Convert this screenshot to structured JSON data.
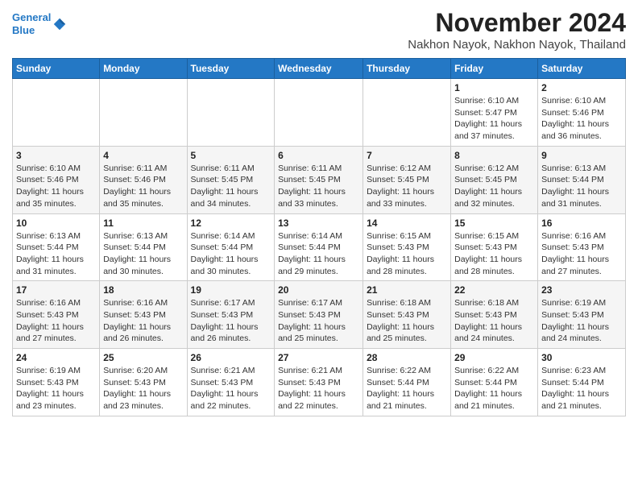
{
  "header": {
    "logo_line1": "General",
    "logo_line2": "Blue",
    "title": "November 2024",
    "subtitle": "Nakhon Nayok, Nakhon Nayok, Thailand"
  },
  "days_of_week": [
    "Sunday",
    "Monday",
    "Tuesday",
    "Wednesday",
    "Thursday",
    "Friday",
    "Saturday"
  ],
  "weeks": [
    [
      {
        "day": "",
        "info": ""
      },
      {
        "day": "",
        "info": ""
      },
      {
        "day": "",
        "info": ""
      },
      {
        "day": "",
        "info": ""
      },
      {
        "day": "",
        "info": ""
      },
      {
        "day": "1",
        "info": "Sunrise: 6:10 AM\nSunset: 5:47 PM\nDaylight: 11 hours\nand 37 minutes."
      },
      {
        "day": "2",
        "info": "Sunrise: 6:10 AM\nSunset: 5:46 PM\nDaylight: 11 hours\nand 36 minutes."
      }
    ],
    [
      {
        "day": "3",
        "info": "Sunrise: 6:10 AM\nSunset: 5:46 PM\nDaylight: 11 hours\nand 35 minutes."
      },
      {
        "day": "4",
        "info": "Sunrise: 6:11 AM\nSunset: 5:46 PM\nDaylight: 11 hours\nand 35 minutes."
      },
      {
        "day": "5",
        "info": "Sunrise: 6:11 AM\nSunset: 5:45 PM\nDaylight: 11 hours\nand 34 minutes."
      },
      {
        "day": "6",
        "info": "Sunrise: 6:11 AM\nSunset: 5:45 PM\nDaylight: 11 hours\nand 33 minutes."
      },
      {
        "day": "7",
        "info": "Sunrise: 6:12 AM\nSunset: 5:45 PM\nDaylight: 11 hours\nand 33 minutes."
      },
      {
        "day": "8",
        "info": "Sunrise: 6:12 AM\nSunset: 5:45 PM\nDaylight: 11 hours\nand 32 minutes."
      },
      {
        "day": "9",
        "info": "Sunrise: 6:13 AM\nSunset: 5:44 PM\nDaylight: 11 hours\nand 31 minutes."
      }
    ],
    [
      {
        "day": "10",
        "info": "Sunrise: 6:13 AM\nSunset: 5:44 PM\nDaylight: 11 hours\nand 31 minutes."
      },
      {
        "day": "11",
        "info": "Sunrise: 6:13 AM\nSunset: 5:44 PM\nDaylight: 11 hours\nand 30 minutes."
      },
      {
        "day": "12",
        "info": "Sunrise: 6:14 AM\nSunset: 5:44 PM\nDaylight: 11 hours\nand 30 minutes."
      },
      {
        "day": "13",
        "info": "Sunrise: 6:14 AM\nSunset: 5:44 PM\nDaylight: 11 hours\nand 29 minutes."
      },
      {
        "day": "14",
        "info": "Sunrise: 6:15 AM\nSunset: 5:43 PM\nDaylight: 11 hours\nand 28 minutes."
      },
      {
        "day": "15",
        "info": "Sunrise: 6:15 AM\nSunset: 5:43 PM\nDaylight: 11 hours\nand 28 minutes."
      },
      {
        "day": "16",
        "info": "Sunrise: 6:16 AM\nSunset: 5:43 PM\nDaylight: 11 hours\nand 27 minutes."
      }
    ],
    [
      {
        "day": "17",
        "info": "Sunrise: 6:16 AM\nSunset: 5:43 PM\nDaylight: 11 hours\nand 27 minutes."
      },
      {
        "day": "18",
        "info": "Sunrise: 6:16 AM\nSunset: 5:43 PM\nDaylight: 11 hours\nand 26 minutes."
      },
      {
        "day": "19",
        "info": "Sunrise: 6:17 AM\nSunset: 5:43 PM\nDaylight: 11 hours\nand 26 minutes."
      },
      {
        "day": "20",
        "info": "Sunrise: 6:17 AM\nSunset: 5:43 PM\nDaylight: 11 hours\nand 25 minutes."
      },
      {
        "day": "21",
        "info": "Sunrise: 6:18 AM\nSunset: 5:43 PM\nDaylight: 11 hours\nand 25 minutes."
      },
      {
        "day": "22",
        "info": "Sunrise: 6:18 AM\nSunset: 5:43 PM\nDaylight: 11 hours\nand 24 minutes."
      },
      {
        "day": "23",
        "info": "Sunrise: 6:19 AM\nSunset: 5:43 PM\nDaylight: 11 hours\nand 24 minutes."
      }
    ],
    [
      {
        "day": "24",
        "info": "Sunrise: 6:19 AM\nSunset: 5:43 PM\nDaylight: 11 hours\nand 23 minutes."
      },
      {
        "day": "25",
        "info": "Sunrise: 6:20 AM\nSunset: 5:43 PM\nDaylight: 11 hours\nand 23 minutes."
      },
      {
        "day": "26",
        "info": "Sunrise: 6:21 AM\nSunset: 5:43 PM\nDaylight: 11 hours\nand 22 minutes."
      },
      {
        "day": "27",
        "info": "Sunrise: 6:21 AM\nSunset: 5:43 PM\nDaylight: 11 hours\nand 22 minutes."
      },
      {
        "day": "28",
        "info": "Sunrise: 6:22 AM\nSunset: 5:44 PM\nDaylight: 11 hours\nand 21 minutes."
      },
      {
        "day": "29",
        "info": "Sunrise: 6:22 AM\nSunset: 5:44 PM\nDaylight: 11 hours\nand 21 minutes."
      },
      {
        "day": "30",
        "info": "Sunrise: 6:23 AM\nSunset: 5:44 PM\nDaylight: 11 hours\nand 21 minutes."
      }
    ]
  ]
}
